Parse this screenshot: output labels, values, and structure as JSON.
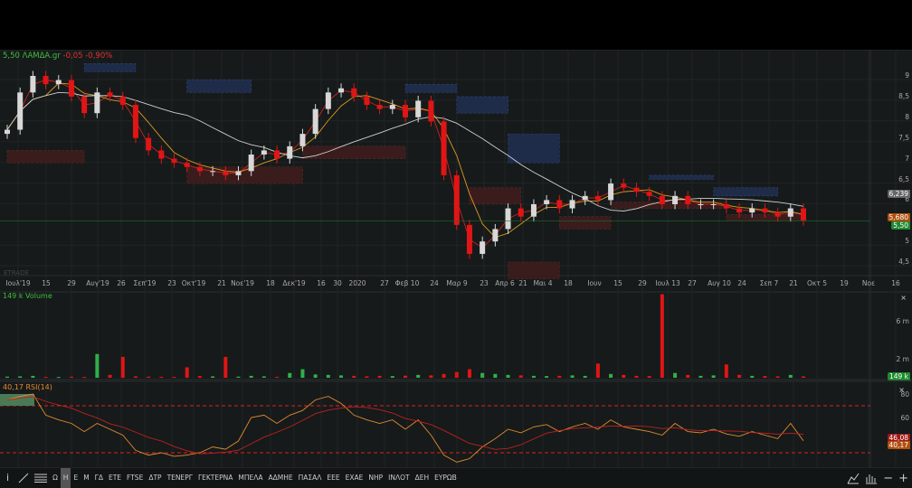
{
  "header": {
    "price": "5,50",
    "symbol": "ΛΑΜΔΑ.gr",
    "change": "-0,05",
    "change_pct": "-0,90%"
  },
  "watermark": "ETRADE",
  "volume_label": "149 k Volume",
  "rsi_label": "40,17 RSI(14)",
  "price_axis": [
    "9",
    "8,5",
    "8",
    "7,5",
    "7",
    "6,5",
    "6",
    "5",
    "4,5"
  ],
  "price_badges": {
    "ma_long": "6,239",
    "ma_mid": "5,680",
    "last": "5,50"
  },
  "volume_axis": [
    "6 m",
    "2 m"
  ],
  "volume_badge": "149 k",
  "rsi_axis": [
    "80",
    "60"
  ],
  "rsi_badges": {
    "signal": "46,08",
    "rsi": "40,17"
  },
  "close_glyph": "×",
  "time_axis": [
    "Ιουλ'19",
    "15",
    "29",
    "Αυγ'19",
    "26",
    "Σεπ'19",
    "23",
    "Οκτ'19",
    "21",
    "Νοε'19",
    "18",
    "Δεκ'19",
    "16",
    "30",
    "2020",
    "27",
    "Φεβ 10",
    "24",
    "Μαρ 9",
    "23",
    "Απρ 6",
    "21",
    "Μαι 4",
    "18",
    "Ιουν",
    "15",
    "29",
    "Ιουλ 13",
    "27",
    "Αυγ 10",
    "24",
    "Σεπ 7",
    "21",
    "Οκτ 5",
    "19",
    "Νοε",
    "16"
  ],
  "toolbar": {
    "items": [
      "Ω",
      "Η",
      "Ε",
      "Μ",
      "ΓΔ",
      "ΕΤΕ",
      "FTSE",
      "ΔΤΡ",
      "ΤΕΝΕΡΓ",
      "ΓΕΚΤΕΡΝΑ",
      "ΜΠΕΛΑ",
      "ΑΔΜΗΕ",
      "ΠΑΣΑΛ",
      "ΕΕΕ",
      "ΕΧΑΕ",
      "ΝΗΡ",
      "ΙΝΛΟΤ",
      "ΔΕΗ",
      "ΕΥΡΩΒ"
    ],
    "active": "Η",
    "info": "i",
    "minus": "−",
    "plus": "+"
  },
  "colors": {
    "up": "#d8d8d8",
    "down": "#e01515",
    "vol_up": "#2fb04a",
    "vol_down": "#e01515",
    "ma_short": "#d02020",
    "ma_mid": "#d89a20",
    "ma_long": "#cfcfcf",
    "rsi": "#e08a30",
    "supply": "#1e2c4a",
    "demand": "#3a1c1c"
  },
  "chart_data": {
    "type": "candlestick",
    "period": "weekly approx",
    "closes": [
      7.7,
      8.6,
      9.0,
      8.8,
      8.9,
      8.5,
      8.1,
      8.6,
      8.5,
      8.3,
      7.5,
      7.2,
      7.0,
      6.9,
      6.8,
      6.7,
      6.7,
      6.6,
      6.7,
      7.1,
      7.2,
      7.0,
      7.3,
      7.6,
      8.2,
      8.6,
      8.7,
      8.5,
      8.3,
      8.2,
      8.3,
      8.0,
      8.4,
      7.9,
      6.6,
      5.4,
      4.7,
      5.0,
      5.3,
      5.8,
      5.6,
      5.9,
      6.0,
      5.8,
      6.0,
      6.1,
      6.0,
      6.4,
      6.3,
      6.2,
      6.1,
      5.9,
      6.1,
      5.9,
      5.9,
      5.9,
      5.8,
      5.7,
      5.8,
      5.7,
      5.6,
      5.8,
      5.5
    ],
    "volume_k": [
      120,
      150,
      200,
      90,
      80,
      110,
      90,
      2500,
      300,
      2200,
      150,
      120,
      100,
      90,
      1100,
      180,
      150,
      2200,
      120,
      200,
      150,
      100,
      500,
      900,
      350,
      300,
      250,
      200,
      150,
      200,
      180,
      220,
      300,
      250,
      400,
      600,
      900,
      500,
      400,
      300,
      250,
      200,
      180,
      200,
      250,
      200,
      1500,
      400,
      300,
      200,
      180,
      8800,
      500,
      300,
      200,
      250,
      1400,
      300,
      200,
      180,
      150,
      300,
      149
    ],
    "rsi": [
      75,
      78,
      80,
      62,
      58,
      55,
      48,
      55,
      50,
      45,
      32,
      28,
      30,
      27,
      28,
      30,
      35,
      33,
      40,
      60,
      62,
      55,
      62,
      66,
      75,
      78,
      72,
      62,
      58,
      55,
      58,
      50,
      58,
      45,
      28,
      22,
      25,
      35,
      42,
      50,
      47,
      52,
      54,
      48,
      52,
      55,
      50,
      58,
      52,
      50,
      48,
      45,
      55,
      48,
      47,
      50,
      46,
      44,
      48,
      45,
      42,
      55,
      40.17
    ],
    "zones": [
      {
        "kind": "supply",
        "from": 6,
        "to": 10,
        "low": 9.1,
        "high": 9.3
      },
      {
        "kind": "supply",
        "from": 14,
        "to": 19,
        "low": 8.6,
        "high": 8.9
      },
      {
        "kind": "supply",
        "from": 31,
        "to": 35,
        "low": 8.6,
        "high": 8.8
      },
      {
        "kind": "supply",
        "from": 35,
        "to": 39,
        "low": 8.1,
        "high": 8.5
      },
      {
        "kind": "supply",
        "from": 39,
        "to": 43,
        "low": 6.9,
        "high": 7.6
      },
      {
        "kind": "supply",
        "from": 50,
        "to": 55,
        "low": 6.5,
        "high": 6.6
      },
      {
        "kind": "supply",
        "from": 55,
        "to": 60,
        "low": 6.1,
        "high": 6.3
      },
      {
        "kind": "demand",
        "from": 0,
        "to": 6,
        "low": 6.9,
        "high": 7.2
      },
      {
        "kind": "demand",
        "from": 14,
        "to": 23,
        "low": 6.4,
        "high": 6.8
      },
      {
        "kind": "demand",
        "from": 23,
        "to": 31,
        "low": 7.0,
        "high": 7.3
      },
      {
        "kind": "demand",
        "from": 36,
        "to": 40,
        "low": 5.9,
        "high": 6.3
      },
      {
        "kind": "demand",
        "from": 39,
        "to": 43,
        "low": 4.1,
        "high": 4.5
      },
      {
        "kind": "demand",
        "from": 43,
        "to": 47,
        "low": 5.3,
        "high": 5.6
      },
      {
        "kind": "demand",
        "from": 47,
        "to": 56,
        "low": 5.8,
        "high": 5.95
      },
      {
        "kind": "demand",
        "from": 56,
        "to": 62,
        "low": 5.5,
        "high": 5.65
      }
    ],
    "ylim": [
      4.2,
      9.6
    ],
    "volume_ylim": [
      0,
      9
    ],
    "rsi_ylim": [
      20,
      90
    ]
  }
}
